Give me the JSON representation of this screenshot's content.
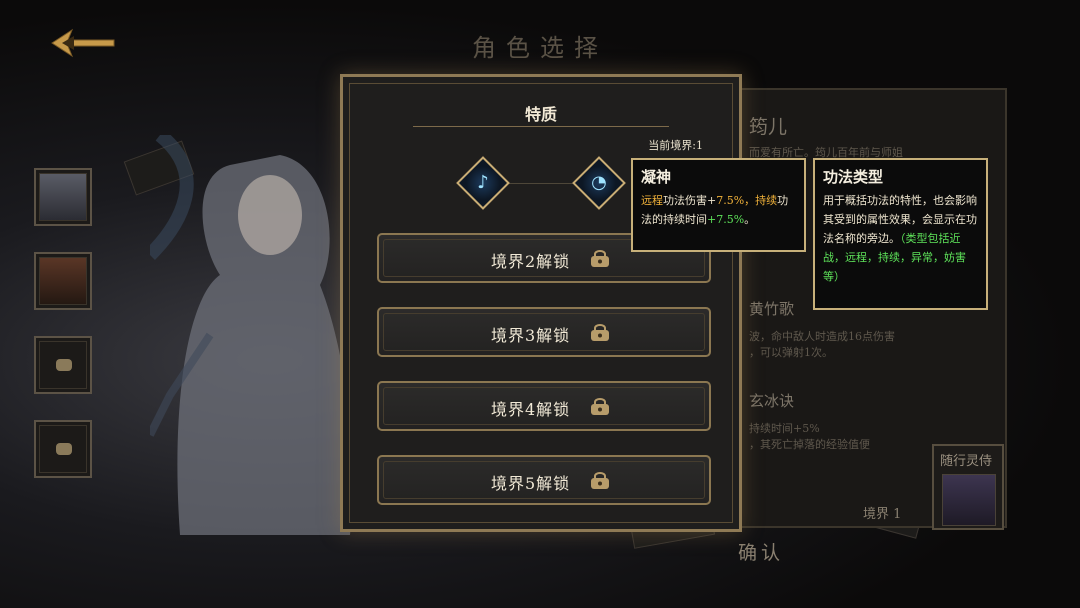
{
  "header": {
    "title": "角色选择"
  },
  "modal": {
    "title": "特质",
    "current_realm": "当前境界:1",
    "buttons": [
      {
        "label": "境界2解锁"
      },
      {
        "label": "境界3解锁"
      },
      {
        "label": "境界4解锁"
      },
      {
        "label": "境界5解锁"
      }
    ]
  },
  "tooltip_trait": {
    "title": "凝神",
    "segments": [
      {
        "text": "远程",
        "color": "yellow"
      },
      {
        "text": "功法伤害+",
        "color": "white"
      },
      {
        "text": "7.5%",
        "color": "yellow"
      },
      {
        "text": "，持续",
        "color": "yellow"
      },
      {
        "text": "功法的持续时间",
        "color": "white"
      },
      {
        "text": "+7.5%",
        "color": "green"
      },
      {
        "text": "。",
        "color": "white"
      }
    ]
  },
  "tooltip_type": {
    "title": "功法类型",
    "body": "用于概括功法的特性，也会影响其受到的属性效果，会显示在功法名称的旁边。",
    "note": "（类型包括近战，远程，持续，异常，妨害等）"
  },
  "character_panel": {
    "name": "筠儿",
    "desc": "而爱有所亡。筠儿百年前与师姐",
    "skills": [
      {
        "name": "黄竹歌",
        "line1": "波，命中敌人时造成16点伤害",
        "line2": "，可以弹射1次。"
      },
      {
        "name": "玄冰诀",
        "line1": "持续时间+5%",
        "line2": "，其死亡掉落的经验值便"
      }
    ],
    "companion_label": "随行灵侍",
    "realm_tag": "境界 1",
    "confirm": "确认"
  },
  "icons": {
    "back": "back-arrow-icon",
    "trait1": "note-gem-icon",
    "trait2": "swirl-gem-icon",
    "lock": "lock-icon"
  },
  "colors": {
    "gold_border": "#c7b07a",
    "highlight_yellow": "#f1b23a",
    "highlight_green": "#5ee35a",
    "background": "#0b0a0a"
  }
}
